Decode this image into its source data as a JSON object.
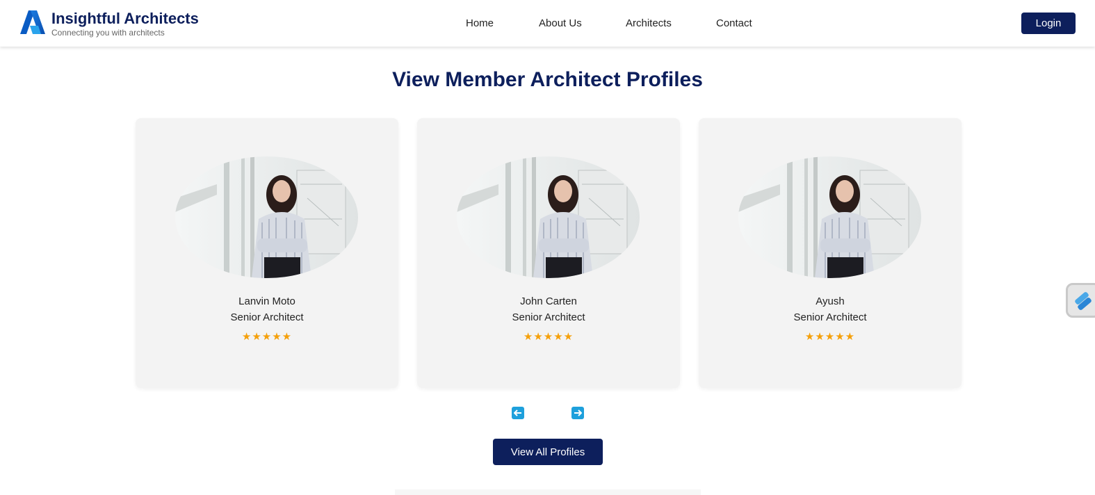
{
  "brand": {
    "name": "Insightful Architects",
    "tagline": "Connecting you with architects",
    "logo_icon": "architect-a-logo-icon"
  },
  "nav": {
    "links": [
      "Home",
      "About Us",
      "Architects",
      "Contact"
    ],
    "login_label": "Login"
  },
  "section": {
    "title": "View Member Architect Profiles"
  },
  "profiles": [
    {
      "name": "Lanvin Moto",
      "role": "Senior Architect",
      "stars": "★★★★★",
      "rating": 5
    },
    {
      "name": "John Carten",
      "role": "Senior Architect",
      "stars": "★★★★★",
      "rating": 5
    },
    {
      "name": "Ayush",
      "role": "Senior Architect",
      "stars": "★★★★★",
      "rating": 5
    }
  ],
  "carousel": {
    "prev_icon": "arrow-left-icon",
    "next_icon": "arrow-right-icon"
  },
  "view_all_label": "View All Profiles",
  "colors": {
    "brand_navy": "#0d1f5c",
    "card_bg": "#f3f3f3",
    "star": "#f5a00a",
    "arrow_blue": "#1ea0dc"
  }
}
